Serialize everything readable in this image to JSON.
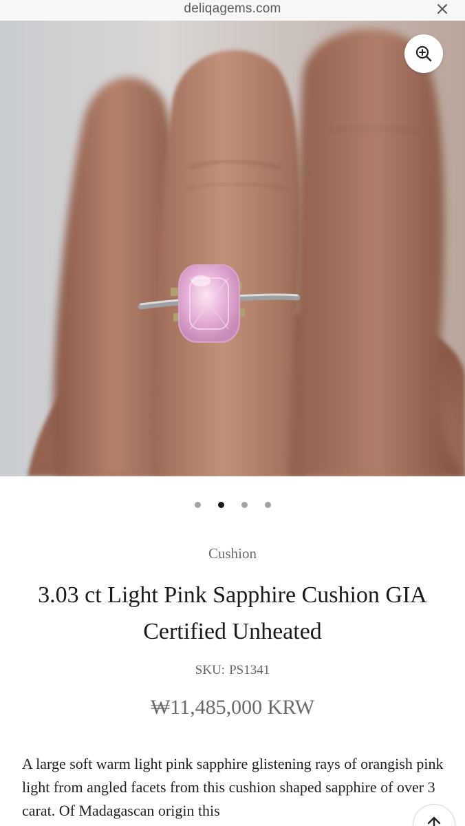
{
  "browser": {
    "url": "deliqagems.com"
  },
  "product": {
    "vendor": "Cushion",
    "title": "3.03 ct Light Pink Sapphire Cushion GIA Certified Unheated",
    "sku_label": "SKU:",
    "sku_value": "PS1341",
    "price": "₩11,485,000 KRW",
    "description": "A large soft warm light pink sapphire glistening rays of orangish pink light from angled facets from this cushion shaped sapphire of over 3 carat. Of Madagascan origin this"
  },
  "gallery": {
    "image_count": 4,
    "active_index": 1
  },
  "icons": {
    "close": "close-icon",
    "zoom": "zoom-in-icon",
    "scroll_top": "arrow-up-icon"
  },
  "colors": {
    "dot_active": "#1a1a1a",
    "dot_inactive": "#a3a3a3",
    "gem": "#e8b3d8",
    "skin": "#a97560"
  }
}
